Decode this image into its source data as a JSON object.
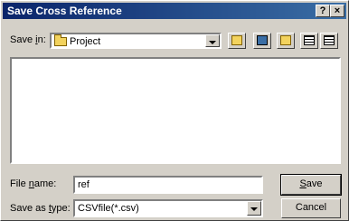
{
  "window": {
    "title": "Save Cross Reference",
    "help_label": "?",
    "close_label": "×"
  },
  "savein": {
    "label_pre": "Save ",
    "label_key": "i",
    "label_post": "n:",
    "value": "Project",
    "tools": [
      "up-one-level-icon",
      "desktop-icon",
      "new-folder-icon",
      "list-view-icon",
      "details-view-icon"
    ]
  },
  "filename": {
    "label_pre": "File ",
    "label_key": "n",
    "label_post": "ame:",
    "value": "ref"
  },
  "filetype": {
    "label_pre": "Save as ",
    "label_key": "t",
    "label_post": "ype:",
    "value": "CSVfile(*.csv)"
  },
  "buttons": {
    "save_key": "S",
    "save_rest": "ave",
    "cancel": "Cancel"
  },
  "colors": {
    "title_start": "#0a246a",
    "title_end": "#3a6ea5",
    "face": "#d4d0c8"
  }
}
